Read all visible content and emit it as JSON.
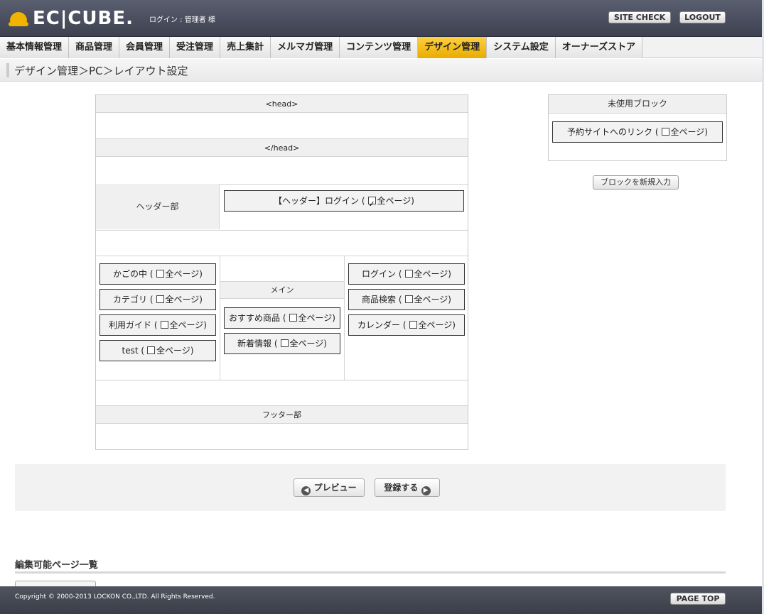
{
  "header": {
    "logo_text": "EC|CUBE.",
    "login_info": "ログイン : 管理者 様",
    "site_check": "SITE CHECK",
    "logout": "LOGOUT"
  },
  "nav": [
    {
      "label": "基本情報管理"
    },
    {
      "label": "商品管理"
    },
    {
      "label": "会員管理"
    },
    {
      "label": "受注管理"
    },
    {
      "label": "売上集計"
    },
    {
      "label": "メルマガ管理"
    },
    {
      "label": "コンテンツ管理"
    },
    {
      "label": "デザイン管理",
      "active": true
    },
    {
      "label": "システム設定"
    },
    {
      "label": "オーナーズストア"
    }
  ],
  "page_title": "デザイン管理＞PC＞レイアウト設定",
  "layout": {
    "head_open": "<head>",
    "head_close": "</head>",
    "header_section": "ヘッダー部",
    "main_label": "メイン",
    "footer_section": "フッター部",
    "all_pages": "全ページ",
    "header_block": "【ヘッダー】ログイン",
    "left_blocks": [
      "かごの中",
      "カテゴリ",
      "利用ガイド",
      "test"
    ],
    "main_blocks": [
      "おすすめ商品",
      "新着情報"
    ],
    "right_blocks": [
      "ログイン",
      "商品検索",
      "カレンダー"
    ]
  },
  "unused": {
    "title": "未使用ブロック",
    "block": "予約サイトへのリンク",
    "new_block_button": "ブロックを新規入力"
  },
  "actions": {
    "preview": "プレビュー",
    "register": "登録する"
  },
  "editable_pages_title": "編集可能ページ一覧",
  "footer": {
    "copyright": "Copyright © 2000-2013 LOCKON CO.,LTD. All Rights Reserved.",
    "page_top": "PAGE TOP"
  }
}
